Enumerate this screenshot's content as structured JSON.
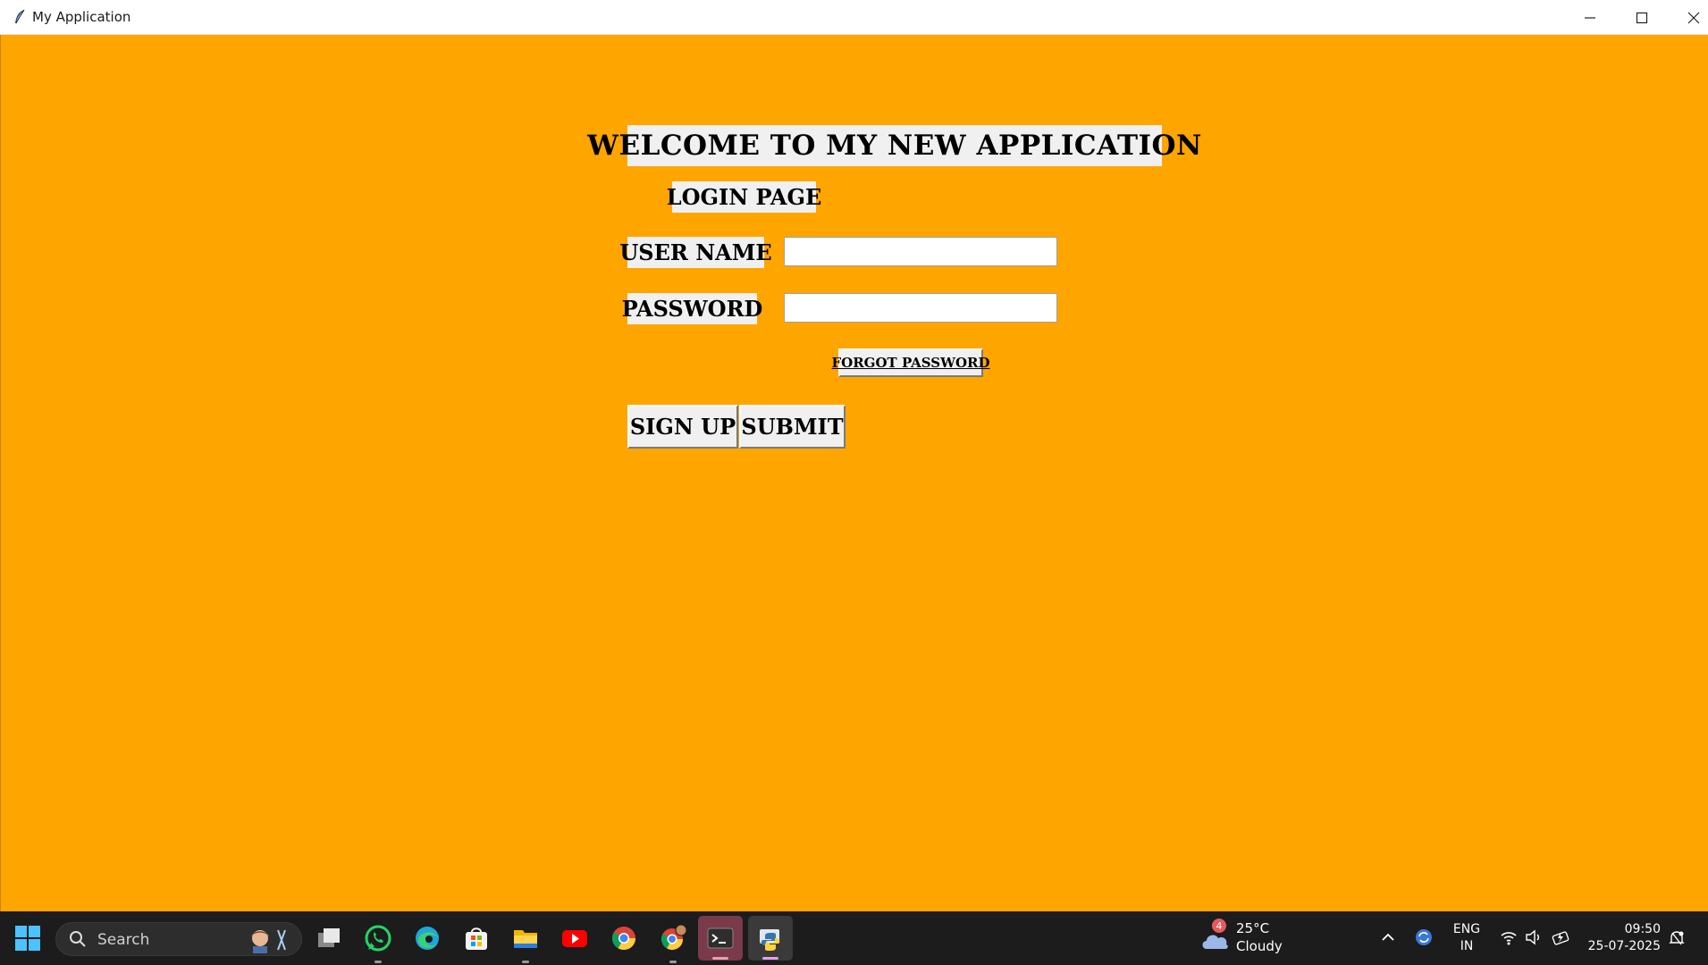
{
  "window": {
    "title": "My Application",
    "background_color": "#ffa500"
  },
  "content": {
    "welcome_heading": "WELCOME TO MY NEW APPLICATION",
    "login_heading": "LOGIN PAGE",
    "username_label": "USER NAME",
    "username_value": "",
    "password_label": "PASSWORD",
    "password_value": "",
    "forgot_password_label": "FORGOT PASSWORD",
    "signup_label": "SIGN UP",
    "submit_label": "SUBMIT"
  },
  "taskbar": {
    "search_placeholder": "Search",
    "pinned_icons": [
      "windows-start-icon",
      "task-view-icon",
      "whatsapp-icon",
      "edge-icon",
      "microsoft-store-icon",
      "file-explorer-icon",
      "youtube-icon",
      "chrome-icon",
      "chrome-profile-icon",
      "terminal-icon",
      "python-icon"
    ],
    "weather_badge": "4",
    "weather_temp": "25°C",
    "weather_desc": "Cloudy",
    "lang_line1": "ENG",
    "lang_line2": "IN",
    "time": "09:50",
    "date": "25-07-2025"
  }
}
